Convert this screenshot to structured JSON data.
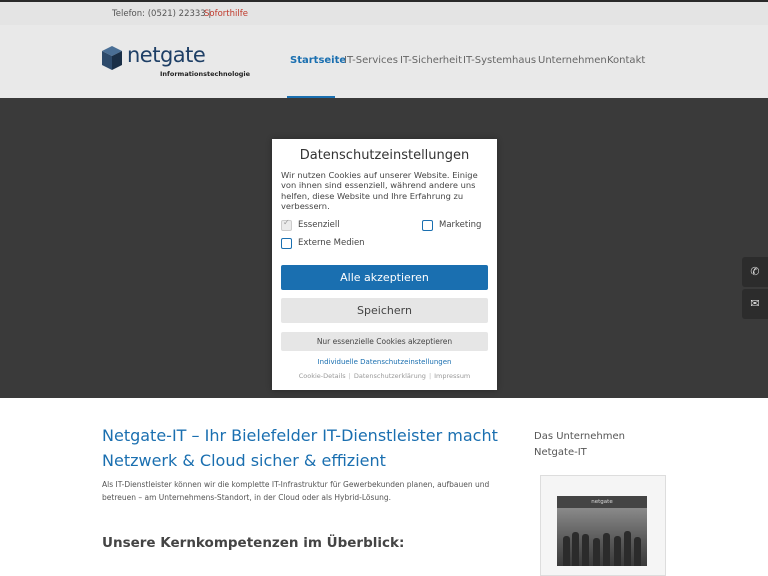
{
  "topbar": {
    "phone": "Telefon: (0521) 22333 |",
    "sofort": "Soforthilfe"
  },
  "logo": {
    "name": "netgate",
    "subtitle": "Informationstechnologie"
  },
  "nav": {
    "items": [
      "Startseite",
      "IT-Services",
      "IT-Sicherheit",
      "IT-Systemhaus",
      "Unternehmen",
      "Kontakt"
    ],
    "active": "Startseite"
  },
  "side_contact": {
    "phone_icon": "phone-icon",
    "mail_icon": "envelope-icon"
  },
  "modal": {
    "title": "Datenschutzeinstellungen",
    "text": "Wir nutzen Cookies auf unserer Website. Einige von ihnen sind essenziell, während andere uns helfen, diese Website und Ihre Erfahrung zu verbessern.",
    "checkboxes": [
      {
        "label": "Essenziell",
        "checked": true,
        "disabled": true
      },
      {
        "label": "Marketing",
        "checked": false,
        "disabled": false
      },
      {
        "label": "Externe Medien",
        "checked": false,
        "disabled": false
      }
    ],
    "accept_all": "Alle akzeptieren",
    "save": "Speichern",
    "only_essential": "Nur essenzielle Cookies akzeptieren",
    "individual": "Individuelle Datenschutzeinstellungen",
    "footer_links": [
      "Cookie-Details",
      "Datenschutzerklärung",
      "Impressum"
    ]
  },
  "content": {
    "title": "Netgate-IT – Ihr Bielefelder IT-Dienstleister macht Netzwerk & Cloud sicher & effizient",
    "text": "Als IT-Dienstleister können wir die komplette IT-Infrastruktur für Gewerbekunden planen, aufbauen und betreuen – am Unternehmens-Standort, in der Cloud oder als Hybrid-Lösung.",
    "h2": "Unsere Kernkompetenzen im Überblick:"
  },
  "aside": {
    "title": "Das Unternehmen Netgate-IT",
    "image_banner": "netgate"
  },
  "colors": {
    "accent": "#1a6fb0",
    "overlay": "#3a3a3a",
    "sofort": "#c0392b"
  }
}
